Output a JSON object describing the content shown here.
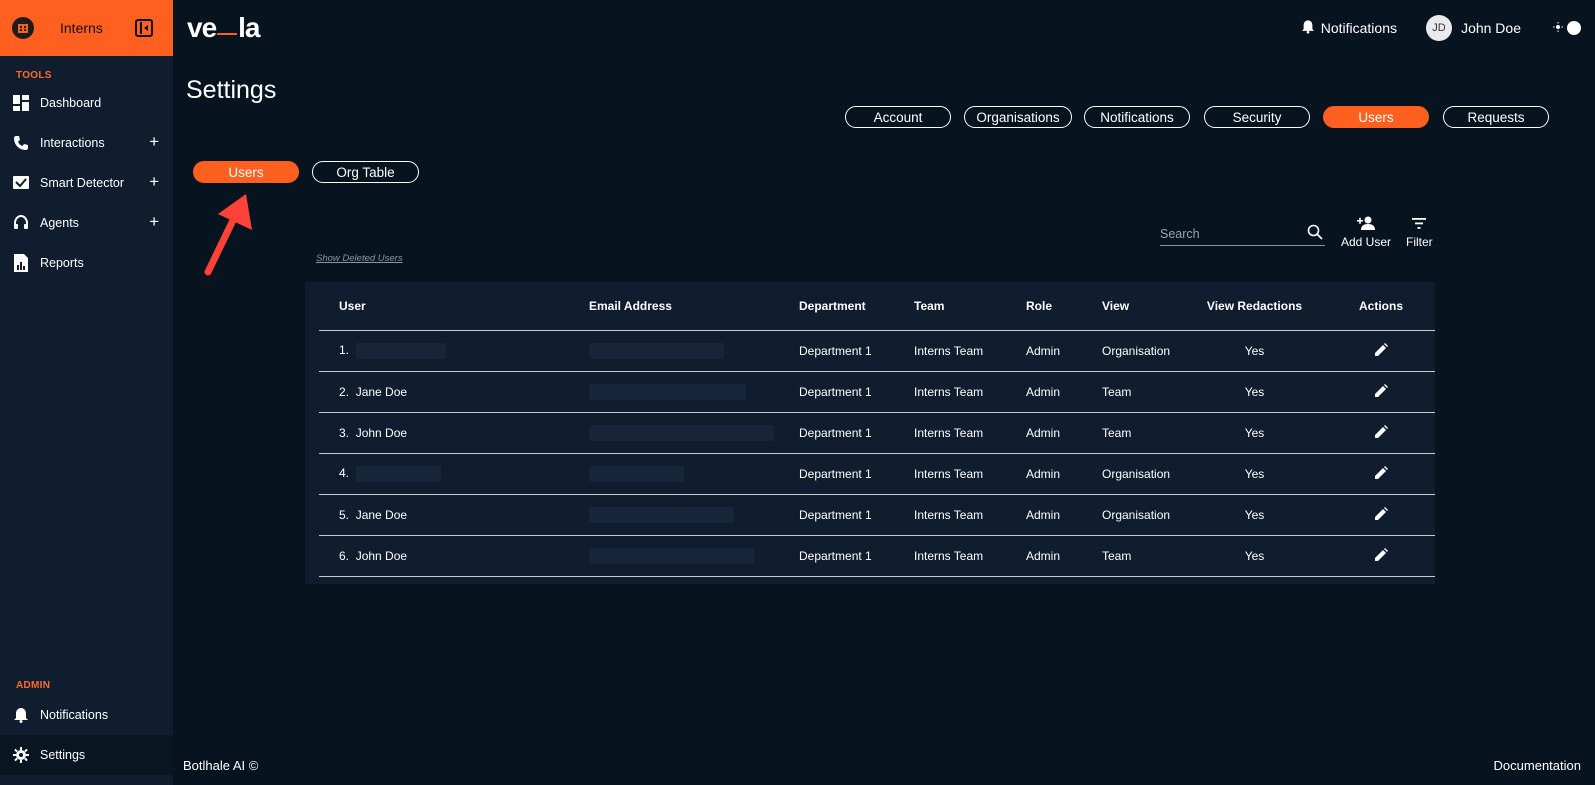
{
  "sidebar": {
    "org_name": "Interns",
    "tools_label": "TOOLS",
    "admin_label": "ADMIN",
    "tools": [
      {
        "label": "Dashboard",
        "icon": "dashboard-icon"
      },
      {
        "label": "Interactions",
        "icon": "phone-icon",
        "expandable": true
      },
      {
        "label": "Smart Detector",
        "icon": "detector-icon",
        "expandable": true
      },
      {
        "label": "Agents",
        "icon": "headset-icon",
        "expandable": true
      },
      {
        "label": "Reports",
        "icon": "report-icon"
      }
    ],
    "admin": [
      {
        "label": "Notifications",
        "icon": "bell-icon"
      },
      {
        "label": "Settings",
        "icon": "gear-icon",
        "active": true
      }
    ]
  },
  "topbar": {
    "notifications_label": "Notifications",
    "avatar_initials": "JD",
    "user_name": "John Doe"
  },
  "page": {
    "title": "Settings",
    "tabs": [
      "Account",
      "Organisations",
      "Notifications",
      "Security",
      "Users",
      "Requests"
    ],
    "active_tab": "Users",
    "subtabs": [
      "Users",
      "Org Table"
    ],
    "active_subtab": "Users"
  },
  "toolbar": {
    "search_placeholder": "Search",
    "add_user_label": "Add User",
    "filter_label": "Filter",
    "show_deleted_label": "Show Deleted Users"
  },
  "table": {
    "headers": [
      "User",
      "Email Address",
      "Department",
      "Team",
      "Role",
      "View",
      "View Redactions",
      "Actions"
    ],
    "rows": [
      {
        "index": "1.",
        "name": "",
        "department": "Department 1",
        "team": "Interns Team",
        "role": "Admin",
        "view": "Organisation",
        "redactions": "Yes"
      },
      {
        "index": "2.",
        "name": "Jane Doe",
        "department": "Department 1",
        "team": "Interns Team",
        "role": "Admin",
        "view": "Team",
        "redactions": "Yes"
      },
      {
        "index": "3.",
        "name": "John Doe",
        "department": "Department 1",
        "team": "Interns Team",
        "role": "Admin",
        "view": "Team",
        "redactions": "Yes"
      },
      {
        "index": "4.",
        "name": "",
        "department": "Department 1",
        "team": "Interns Team",
        "role": "Admin",
        "view": "Organisation",
        "redactions": "Yes"
      },
      {
        "index": "5.",
        "name": "Jane Doe",
        "department": "Department 1",
        "team": "Interns Team",
        "role": "Admin",
        "view": "Organisation",
        "redactions": "Yes"
      },
      {
        "index": "6.",
        "name": "John Doe",
        "department": "Department 1",
        "team": "Interns Team",
        "role": "Admin",
        "view": "Team",
        "redactions": "Yes"
      }
    ]
  },
  "footer": {
    "copyright": "Botlhale AI ©",
    "documentation": "Documentation"
  },
  "colors": {
    "accent": "#ff5f1f",
    "background": "#081320",
    "panel": "#0f1d2e"
  }
}
